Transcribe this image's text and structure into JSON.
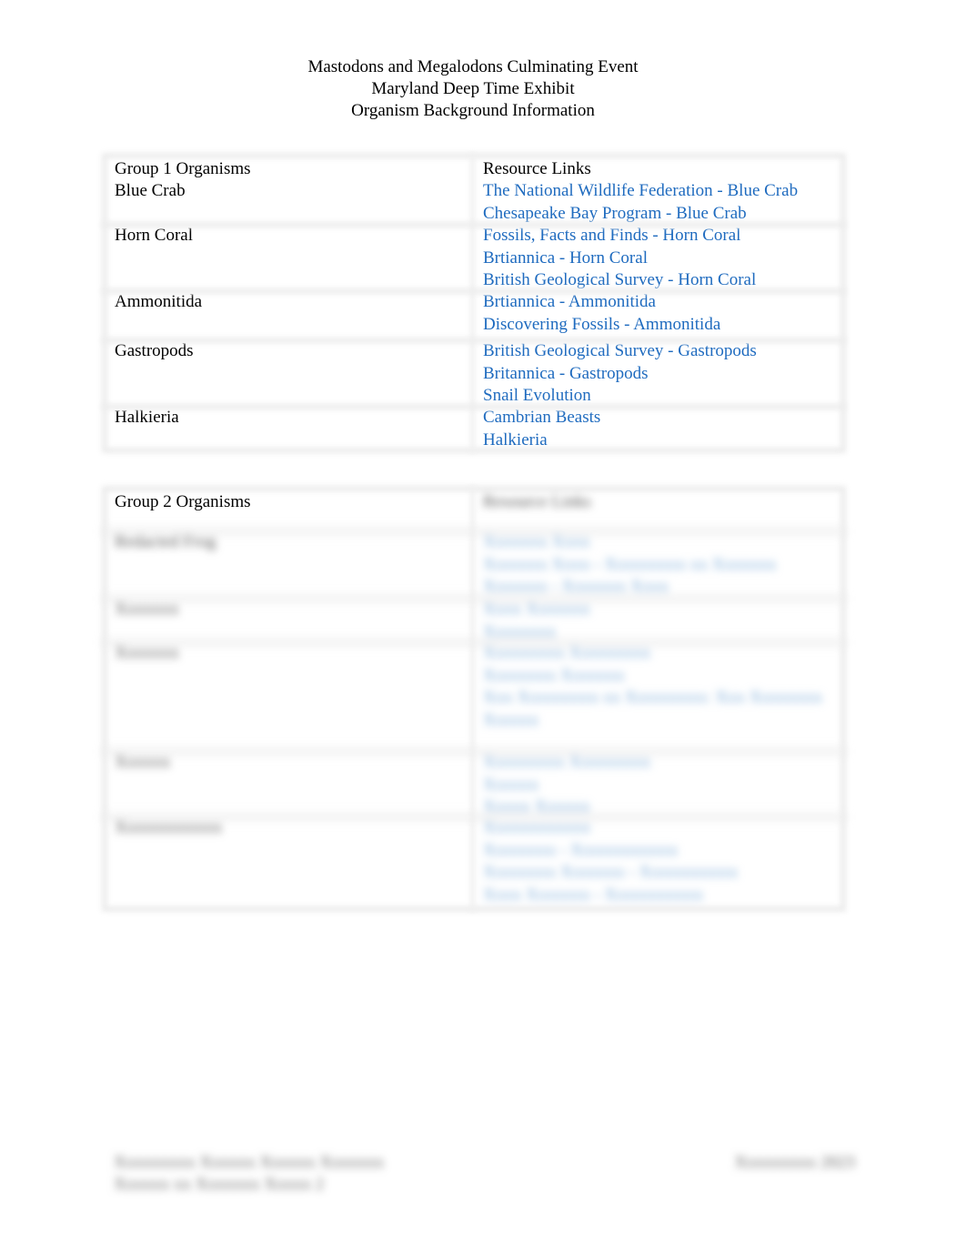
{
  "header": {
    "line1": "Mastodons and Megalodons Culminating Event",
    "line2": "Maryland Deep Time Exhibit",
    "line3": "Organism Background Information"
  },
  "colors": {
    "link": "#1f6bbf",
    "text": "#000000"
  },
  "group1": {
    "header_left": "Group 1 Organisms",
    "header_right": "Resource Links",
    "rows": [
      {
        "organism": "Blue Crab",
        "links": [
          "The National Wildlife Federation - Blue Crab",
          "Chesapeake Bay Program - Blue Crab"
        ]
      },
      {
        "organism": "Horn Coral",
        "links": [
          "Fossils, Facts and Finds - Horn Coral",
          "Brtiannica - Horn Coral",
          "British Geological Survey - Horn Coral"
        ]
      },
      {
        "organism": "Ammonitida",
        "links": [
          "Brtiannica - Ammonitida",
          "Discovering Fossils - Ammonitida"
        ]
      },
      {
        "organism": "Gastropods",
        "links": [
          "British Geological Survey - Gastropods",
          "Britannica - Gastropods",
          "Snail Evolution"
        ]
      },
      {
        "organism": "Halkieria",
        "links": [
          "Cambrian Beasts",
          "Halkieria"
        ]
      }
    ]
  },
  "group2": {
    "header_left": "Group 2 Organisms",
    "header_right": "Resource Links",
    "obscured": true,
    "rows": [
      {
        "organism": "Redacted Frog",
        "links": [
          "Xxxxxxx Xxxx",
          "Xxxxxxx Xxxx - Xxxxxxxxx xx Xxxxxxx",
          "Xxxxxxx - Xxxxxxx Xxxx"
        ]
      },
      {
        "organism": "Xxxxxxx",
        "links": [
          "Xxxx Xxxxxxx",
          "Xxxxxxxx"
        ]
      },
      {
        "organism": "Xxxxxxx",
        "links": [
          "Xxxxxxxxx Xxxxxxxxx",
          "Xxxxxxxx Xxxxxxx",
          "Xxx Xxxxxxxxx xx Xxxxxxxxx: Xxx Xxxxxxxx",
          "Xxxxxx"
        ]
      },
      {
        "organism": "Xxxxxx",
        "links": [
          "Xxxxxxxxx Xxxxxxxxx",
          "Xxxxxx",
          "Xxxxx Xxxxxx"
        ]
      },
      {
        "organism": "Xxxxxxxxxxxx",
        "links": [
          "Xxxxxxxxxxxx",
          "Xxxxxxxx - Xxxxxxxxxxxx",
          "Xxxxxxxx Xxxxxxx - Xxxxxxxxxxx",
          "Xxxx Xxxxxxx - Xxxxxxxxxxx"
        ]
      }
    ]
  },
  "footer": {
    "left_line1": "Xxxxxxxxx Xxxxxx Xxxxxx Xxxxxxx",
    "left_line2": "Xxxxxx xx Xxxxxxx Xxxxx 2",
    "right": "Xxxxxxxxx 2023"
  }
}
